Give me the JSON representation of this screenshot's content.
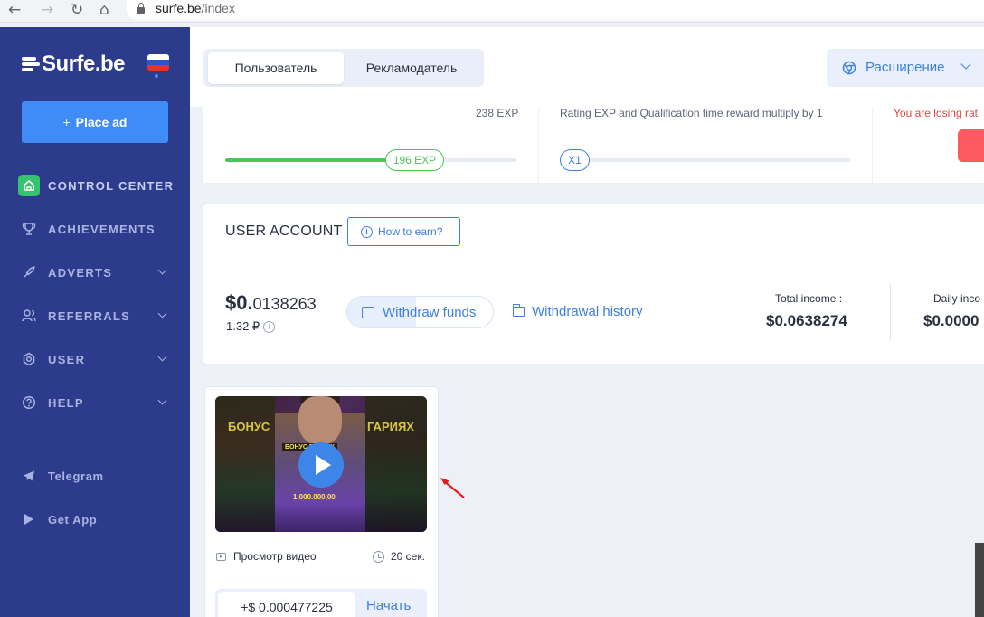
{
  "browser": {
    "url_host": "surfe.be",
    "url_path": "/index",
    "nav": {
      "back": "←",
      "forward": "→",
      "reload": "↻",
      "home": "⌂"
    }
  },
  "sidebar": {
    "logo_text": "Surfe.be",
    "language_flag": "ru",
    "place_ad": {
      "plus": "+",
      "label": "Place ad"
    },
    "menu": [
      {
        "label": "CONTROL CENTER",
        "icon": "home-icon",
        "active": true,
        "expandable": false
      },
      {
        "label": "ACHIEVEMENTS",
        "icon": "trophy-icon",
        "active": false,
        "expandable": false
      },
      {
        "label": "ADVERTS",
        "icon": "rocket-icon",
        "active": false,
        "expandable": true
      },
      {
        "label": "REFERRALS",
        "icon": "users-icon",
        "active": false,
        "expandable": true
      },
      {
        "label": "USER",
        "icon": "gear-icon",
        "active": false,
        "expandable": true
      },
      {
        "label": "HELP",
        "icon": "help-icon",
        "active": false,
        "expandable": true
      }
    ],
    "links": [
      {
        "label": "Telegram",
        "icon": "telegram-icon"
      },
      {
        "label": "Get App",
        "icon": "play-store-icon"
      }
    ]
  },
  "header": {
    "tabs": [
      {
        "label": "Пользователь",
        "active": true
      },
      {
        "label": "Рекламодатель",
        "active": false
      }
    ],
    "extension_button": "Расширение"
  },
  "stats": {
    "exp_total": "238 EXP",
    "exp_current": "196 EXP",
    "exp_progress": 0.56,
    "rating_text": "Rating EXP and Qualification time reward multiply by 1",
    "multiplier": "X1",
    "losing_text": "You are losing rat"
  },
  "account": {
    "title": "USER ACCOUNT",
    "how_to_earn": "How to earn?",
    "balance_main": "$0.",
    "balance_decimals": "0138263",
    "balance_rub": "1.32 ₽",
    "info_icon": "i",
    "withdraw_label": "Withdraw funds",
    "history_label": "Withdrawal history",
    "total_income_label": "Total income :",
    "total_income_value": "$0.0638274",
    "daily_income_label": "Daily inco",
    "daily_income_value": "$0.0000"
  },
  "task": {
    "thumb_text_left": "БОНУС",
    "thumb_text_right": "ГАРИЯХ",
    "thumb_text_mid": "БОНУС ГАРИЯХ",
    "thumb_amount": "1.000.000,00",
    "type_label": "Просмотр видео",
    "duration": "20 сек.",
    "reward": "+$ 0.000477225",
    "start_label": "Начать"
  },
  "colors": {
    "sidebar": "#2c3b8c",
    "accent": "#3e7fe0",
    "success": "#36c36f",
    "danger": "#ff5a5f"
  }
}
